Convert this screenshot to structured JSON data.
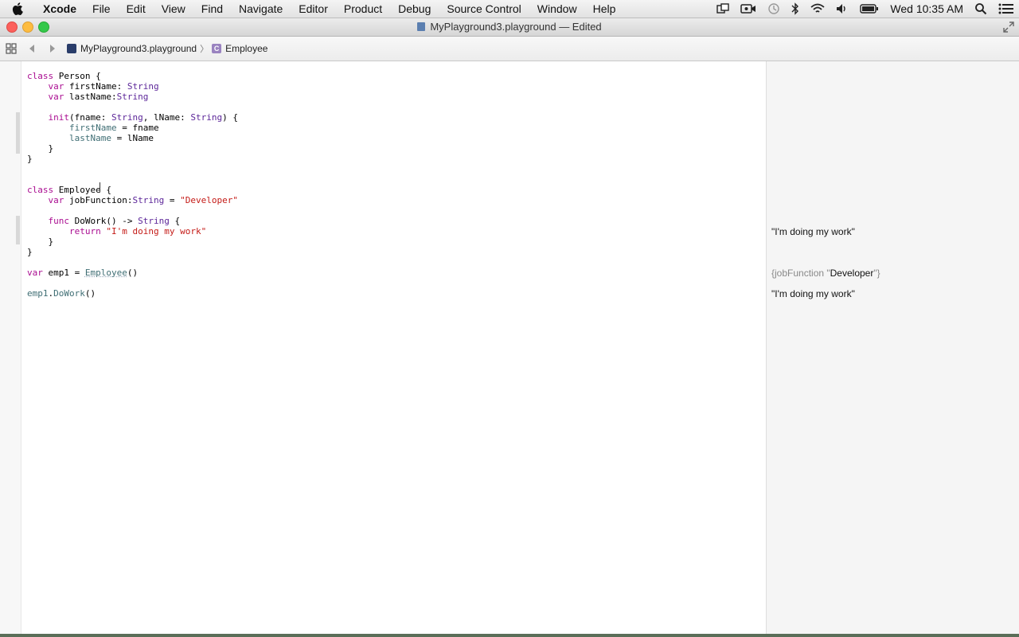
{
  "menubar": {
    "app_name": "Xcode",
    "items": [
      "File",
      "Edit",
      "View",
      "Find",
      "Navigate",
      "Editor",
      "Product",
      "Debug",
      "Source Control",
      "Window",
      "Help"
    ],
    "clock": "Wed 10:35 AM"
  },
  "window": {
    "title": "MyPlayground3.playground — Edited"
  },
  "jumpbar": {
    "crumbs": [
      "MyPlayground3.playground",
      "Employee"
    ]
  },
  "code": {
    "lines": [
      "class Person {",
      "var firstName: String",
      "var lastName:String",
      "init(fname: String, lName: String) {",
      "firstName = fname",
      "lastName = lName",
      "}",
      "}",
      "class Employee {",
      "var jobFunction:String = \"Developer\"",
      "func DoWork() -> String {",
      "return \"I'm doing my work\"",
      "}",
      "}",
      "var emp1 = Employee()",
      "emp1.DoWork()"
    ]
  },
  "results": {
    "line_return": "\"I'm doing my work\"",
    "emp1_key": "{jobFunction \"",
    "emp1_value": "Developer",
    "emp1_close": "\"}",
    "dowork_result": "\"I'm doing my work\""
  },
  "colors": {
    "keyword": "#aa0d91",
    "type": "#5c2699",
    "string": "#c41a16",
    "property": "#3f6e74"
  },
  "icons": {
    "apple": "apple-logo-icon",
    "status": [
      "screen-share-icon",
      "facetime-camera-icon",
      "time-machine-icon",
      "bluetooth-icon",
      "wifi-icon",
      "volume-icon",
      "battery-icon",
      "spotlight-search-icon",
      "notification-center-icon"
    ]
  }
}
